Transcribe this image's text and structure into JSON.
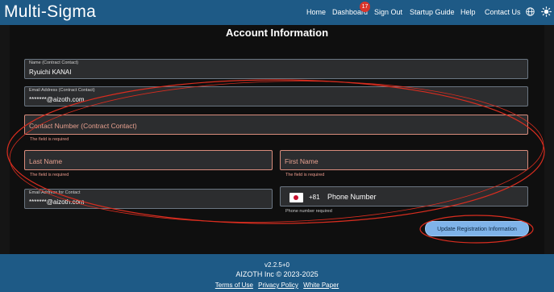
{
  "header": {
    "brand": "Multi-Sigma",
    "nav": {
      "home": "Home",
      "dashboard": "Dashboard",
      "dashboard_badge": "17",
      "sign_out": "Sign Out",
      "startup_guide": "Startup Guide",
      "help": "Help",
      "contact_us": "Contact Us"
    },
    "icons": [
      "globe-icon",
      "sun-icon"
    ]
  },
  "form": {
    "title": "Account Information",
    "contract_name": {
      "label": "Name (Contract Contact)",
      "value": "Ryuichi KANAI"
    },
    "contract_email": {
      "label": "Email Address (Contract Contact)",
      "value": "*******@aizoth.com"
    },
    "contract_phone": {
      "placeholder": "Contact Number (Contract Contact)",
      "error": "The field is required"
    },
    "last_name": {
      "placeholder": "Last Name",
      "error": "The field is required"
    },
    "first_name": {
      "placeholder": "First Name",
      "error": "The field is required"
    },
    "contact_email": {
      "label": "Email Address for Contact",
      "value": "*******@aizoth.com"
    },
    "phone": {
      "country_code": "+81",
      "placeholder": "Phone Number",
      "hint": "Phone number required",
      "flag": "japan-flag-icon"
    },
    "submit_label": "Update Registration Information"
  },
  "footer": {
    "version": "v2.2.5+0",
    "copyright": "AIZOTH Inc © 2023-2025",
    "links": [
      "Terms of Use",
      "Privacy Policy",
      "White Paper"
    ]
  },
  "colors": {
    "header_bg": "#1e5a86",
    "page_bg": "#151515",
    "button_bg": "#7fb3e9",
    "error_text": "#ec9a8c",
    "annotation": "#d92d1f"
  }
}
